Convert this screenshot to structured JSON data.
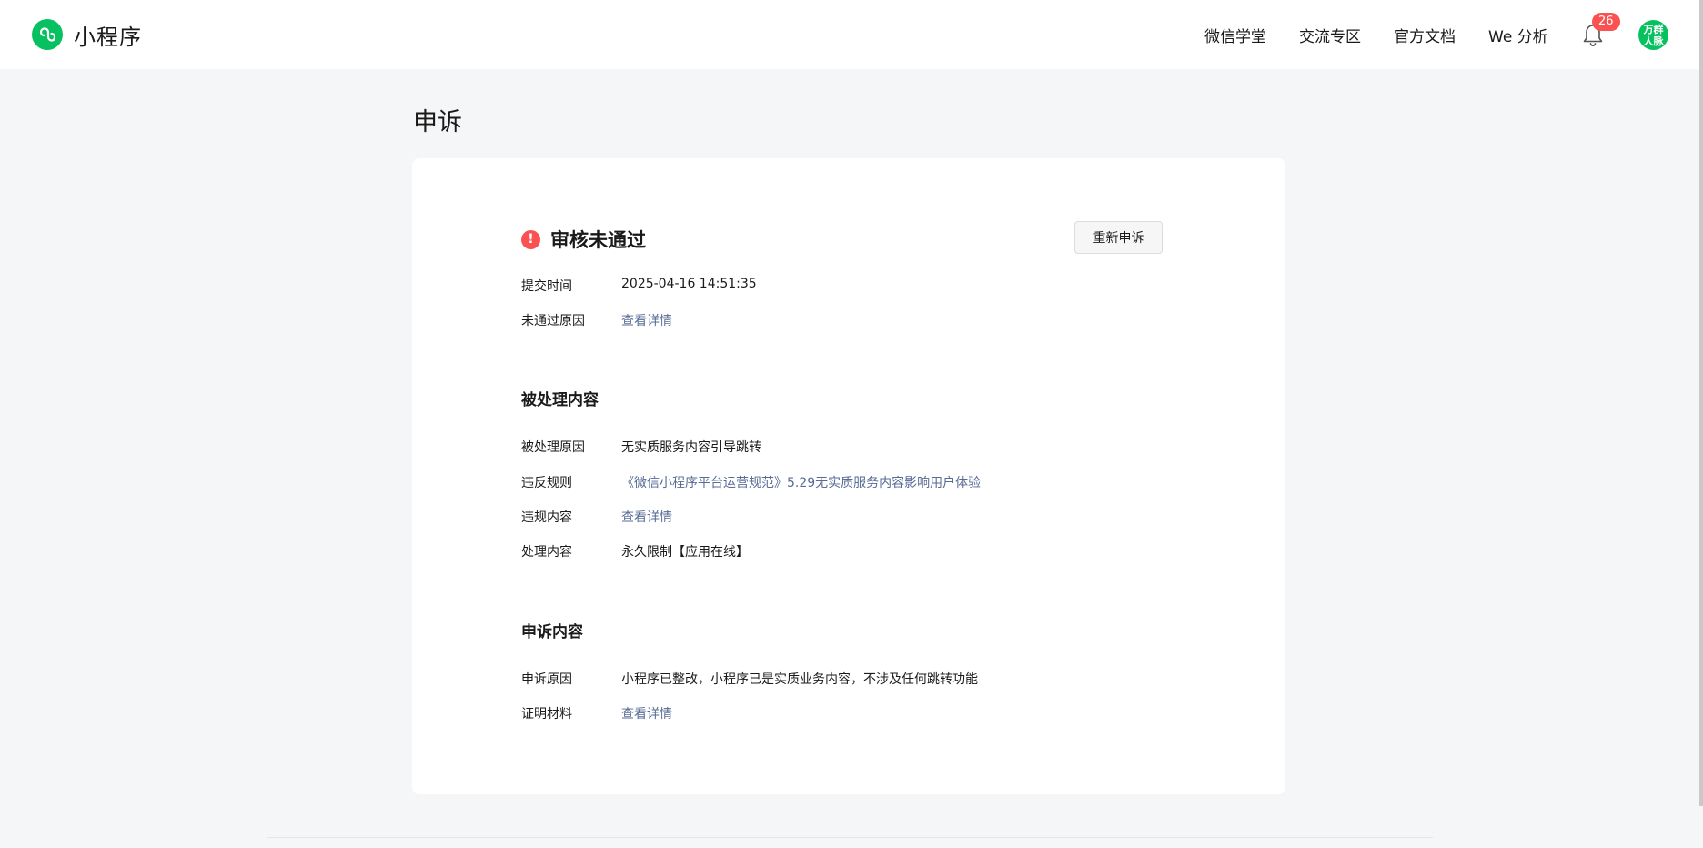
{
  "header": {
    "brand": "小程序",
    "nav": [
      "微信学堂",
      "交流专区",
      "官方文档",
      "We 分析"
    ],
    "notification_count": "26",
    "avatar_lines": [
      "万群",
      "人脉"
    ]
  },
  "page": {
    "title": "申诉"
  },
  "status": {
    "icon": "!",
    "text": "审核未通过",
    "reappeal_button": "重新申诉",
    "rows": [
      {
        "label": "提交时间",
        "value": "2025-04-16 14:51:35"
      },
      {
        "label": "未通过原因",
        "value": "查看详情"
      }
    ]
  },
  "handled": {
    "title": "被处理内容",
    "rows": [
      {
        "label": "被处理原因",
        "value": "无实质服务内容引导跳转"
      },
      {
        "label": "违反规则",
        "value": "《微信小程序平台运营规范》5.29无实质服务内容影响用户体验"
      },
      {
        "label": "违规内容",
        "value": "查看详情"
      },
      {
        "label": "处理内容",
        "value": "永久限制【应用在线】"
      }
    ]
  },
  "appeal": {
    "title": "申诉内容",
    "rows": [
      {
        "label": "申诉原因",
        "value": "小程序已整改，小程序已是实质业务内容，不涉及任何跳转功能"
      },
      {
        "label": "证明材料",
        "value": "查看详情"
      }
    ]
  },
  "colors": {
    "brand": "#07c160",
    "error": "#fa5151",
    "link": "#576b95",
    "background": "#f5f6f7"
  },
  "icons": [
    "miniprogram-logo-icon",
    "bell-icon",
    "error-icon"
  ]
}
